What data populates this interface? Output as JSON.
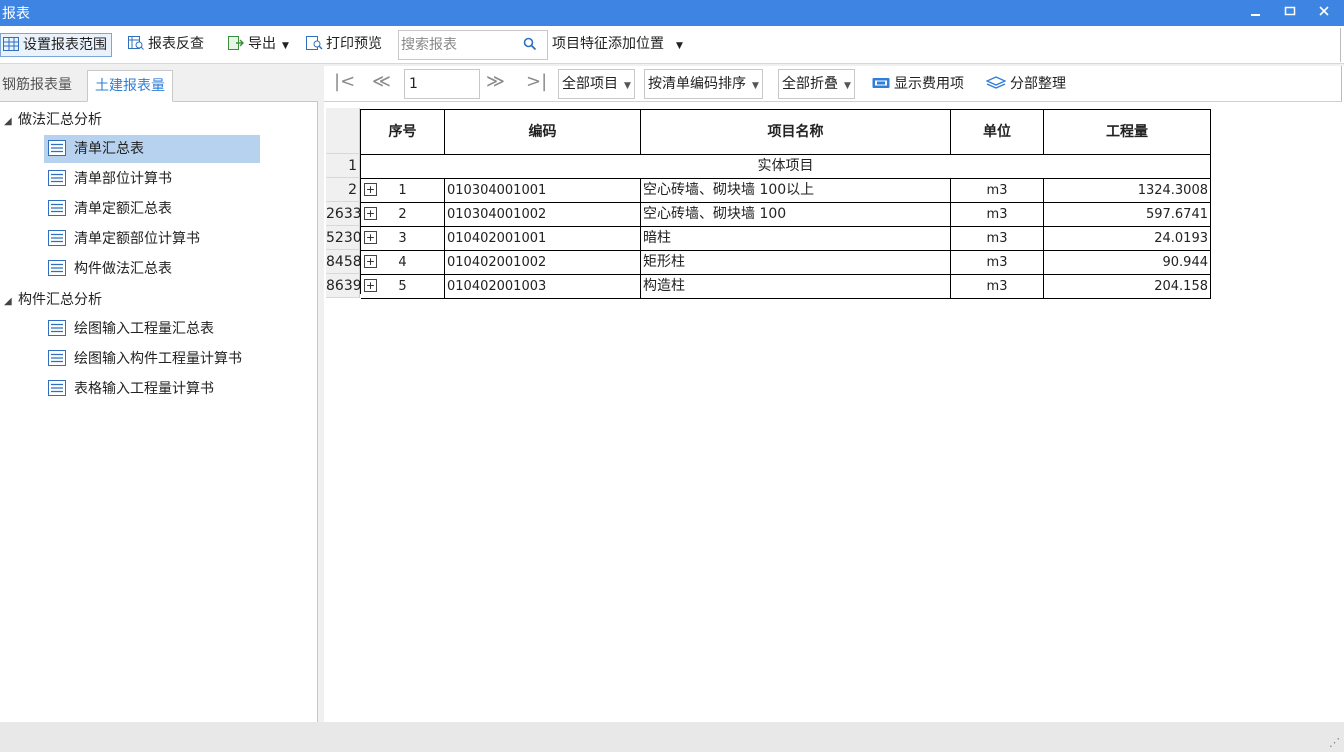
{
  "window": {
    "title": "报表"
  },
  "toolbar": {
    "set_range": "设置报表范围",
    "report_check": "报表反查",
    "export": "导出",
    "print_preview": "打印预览",
    "search_placeholder": "搜索报表",
    "feature_position": "项目特征添加位置"
  },
  "tabs": [
    {
      "label": "钢筋报表量",
      "active": false
    },
    {
      "label": "土建报表量",
      "active": true
    }
  ],
  "tree": [
    {
      "label": "做法汇总分析",
      "items": [
        "清单汇总表",
        "清单部位计算书",
        "清单定额汇总表",
        "清单定额部位计算书",
        "构件做法汇总表"
      ]
    },
    {
      "label": "构件汇总分析",
      "items": [
        "绘图输入工程量汇总表",
        "绘图输入构件工程量计算书",
        "表格输入工程量计算书"
      ]
    }
  ],
  "selected_item": "清单汇总表",
  "nav": {
    "page": "1",
    "filter": "全部项目",
    "sort": "按清单编码排序",
    "fold": "全部折叠",
    "show_fee": "显示费用项",
    "section_arrange": "分部整理"
  },
  "table": {
    "headers": [
      "序号",
      "编码",
      "项目名称",
      "单位",
      "工程量"
    ],
    "group_row": {
      "row_num": "1",
      "label": "实体项目"
    },
    "rows": [
      {
        "row_num": "2",
        "seq": "1",
        "code": "010304001001",
        "name": "空心砖墙、砌块墙  100以上",
        "unit": "m3",
        "qty": "1324.3008"
      },
      {
        "row_num": "2633",
        "seq": "2",
        "code": "010304001002",
        "name": "空心砖墙、砌块墙 100",
        "unit": "m3",
        "qty": "597.6741"
      },
      {
        "row_num": "5230",
        "seq": "3",
        "code": "010402001001",
        "name": "暗柱",
        "unit": "m3",
        "qty": "24.0193"
      },
      {
        "row_num": "8458",
        "seq": "4",
        "code": "010402001002",
        "name": "矩形柱",
        "unit": "m3",
        "qty": "90.944"
      },
      {
        "row_num": "8639",
        "seq": "5",
        "code": "010402001003",
        "name": "构造柱",
        "unit": "m3",
        "qty": "204.158"
      }
    ]
  },
  "colors": {
    "titlebar": "#3d84e3",
    "selected": "#b7d2ef",
    "accent": "#2f7fd8"
  }
}
